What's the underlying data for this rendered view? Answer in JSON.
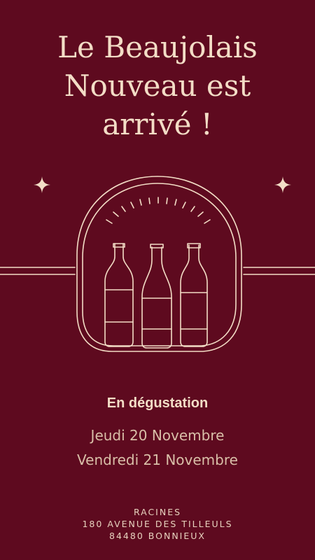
{
  "title": {
    "line1": "Le Beaujolais",
    "line2": "Nouveau est",
    "line3": "arrivé !"
  },
  "event": {
    "label": "En dégustation",
    "dates": [
      "Jeudi 20 Novembre",
      "Vendredi 21 Novembre"
    ]
  },
  "venue": {
    "name": "RACINES",
    "street": "180 AVENUE DES TILLEULS",
    "city": "84480 BONNIEUX"
  },
  "colors": {
    "background": "#5e0a1f",
    "text": "#f3ddc6"
  },
  "icons": [
    "sparkle-icon",
    "sparkle-icon",
    "wine-bottles-illustration"
  ]
}
